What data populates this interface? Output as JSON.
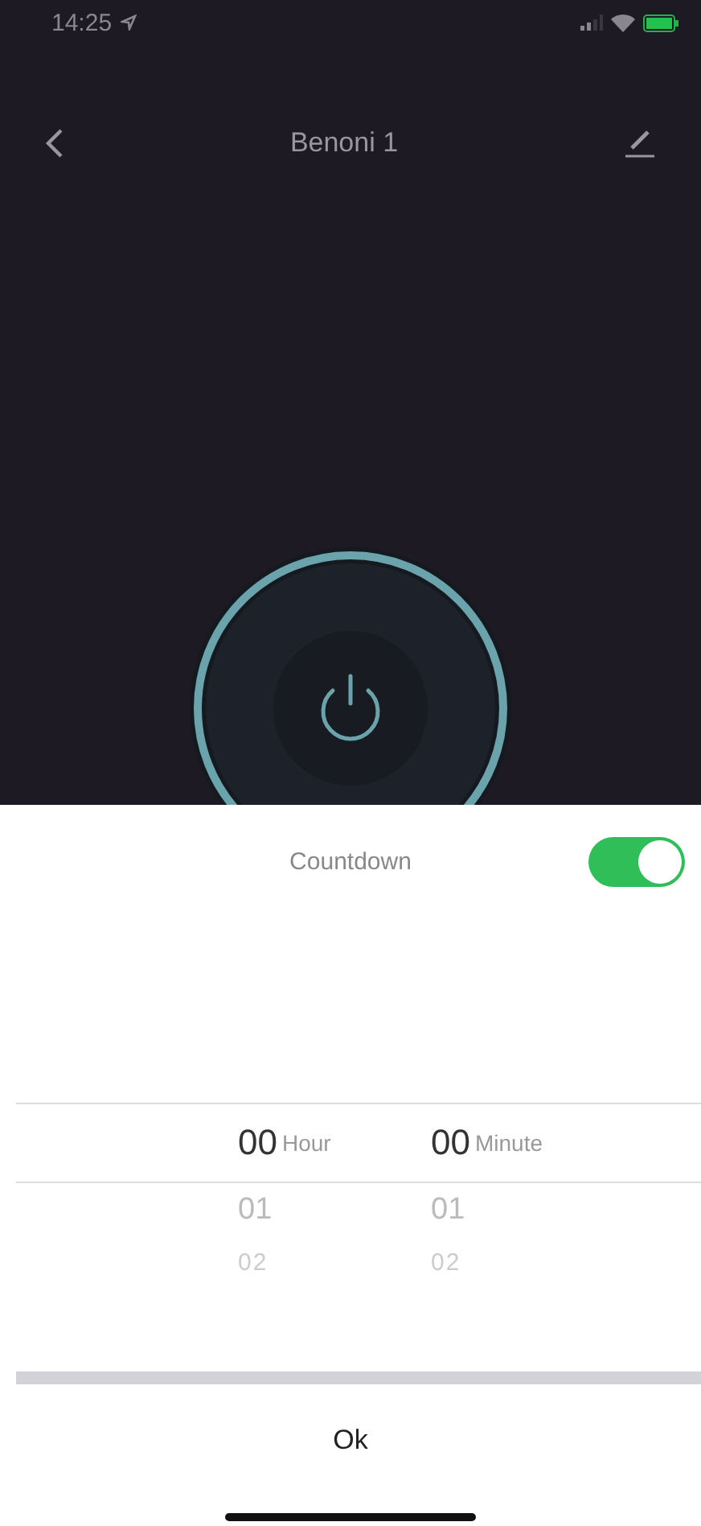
{
  "status_bar": {
    "time": "14:25"
  },
  "nav": {
    "title": "Benoni 1"
  },
  "countdown": {
    "label": "Countdown",
    "on": true
  },
  "picker": {
    "columns": [
      {
        "unit": "Hour",
        "rows": [
          {
            "value": "00",
            "selected": true
          },
          {
            "value": "01",
            "selected": false
          },
          {
            "value": "02",
            "selected": false
          }
        ]
      },
      {
        "unit": "Minute",
        "rows": [
          {
            "value": "00",
            "selected": true
          },
          {
            "value": "01",
            "selected": false
          },
          {
            "value": "02",
            "selected": false
          }
        ]
      }
    ]
  },
  "ok_button": "Ok"
}
